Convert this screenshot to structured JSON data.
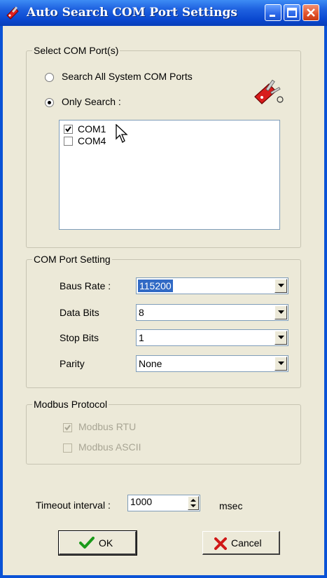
{
  "window": {
    "title": "Auto Search COM Port Settings"
  },
  "select_ports": {
    "legend": "Select COM Port(s)",
    "radio_all": "Search All System COM Ports",
    "radio_only": "Only Search :",
    "ports": [
      {
        "label": "COM1",
        "checked": true
      },
      {
        "label": "COM4",
        "checked": false
      }
    ]
  },
  "port_setting": {
    "legend": "COM Port Setting",
    "fields": [
      {
        "label": "Baus Rate :",
        "value": "115200"
      },
      {
        "label": "Data Bits",
        "value": "8"
      },
      {
        "label": "Stop Bits",
        "value": "1"
      },
      {
        "label": "Parity",
        "value": "None"
      }
    ]
  },
  "modbus": {
    "legend": "Modbus Protocol",
    "rtu": "Modbus RTU",
    "ascii": "Modbus ASCII"
  },
  "timeout": {
    "label": "Timeout interval :",
    "value": "1000",
    "unit": "msec"
  },
  "buttons": {
    "ok": "OK",
    "cancel": "Cancel"
  },
  "icons": {
    "title": "swiss-knife-icon",
    "ok": "checkmark-icon",
    "cancel": "red-x-icon"
  },
  "colors": {
    "titlebar": "#0a52d6",
    "dialog_bg": "#ece9d8",
    "selection": "#316ac5"
  }
}
